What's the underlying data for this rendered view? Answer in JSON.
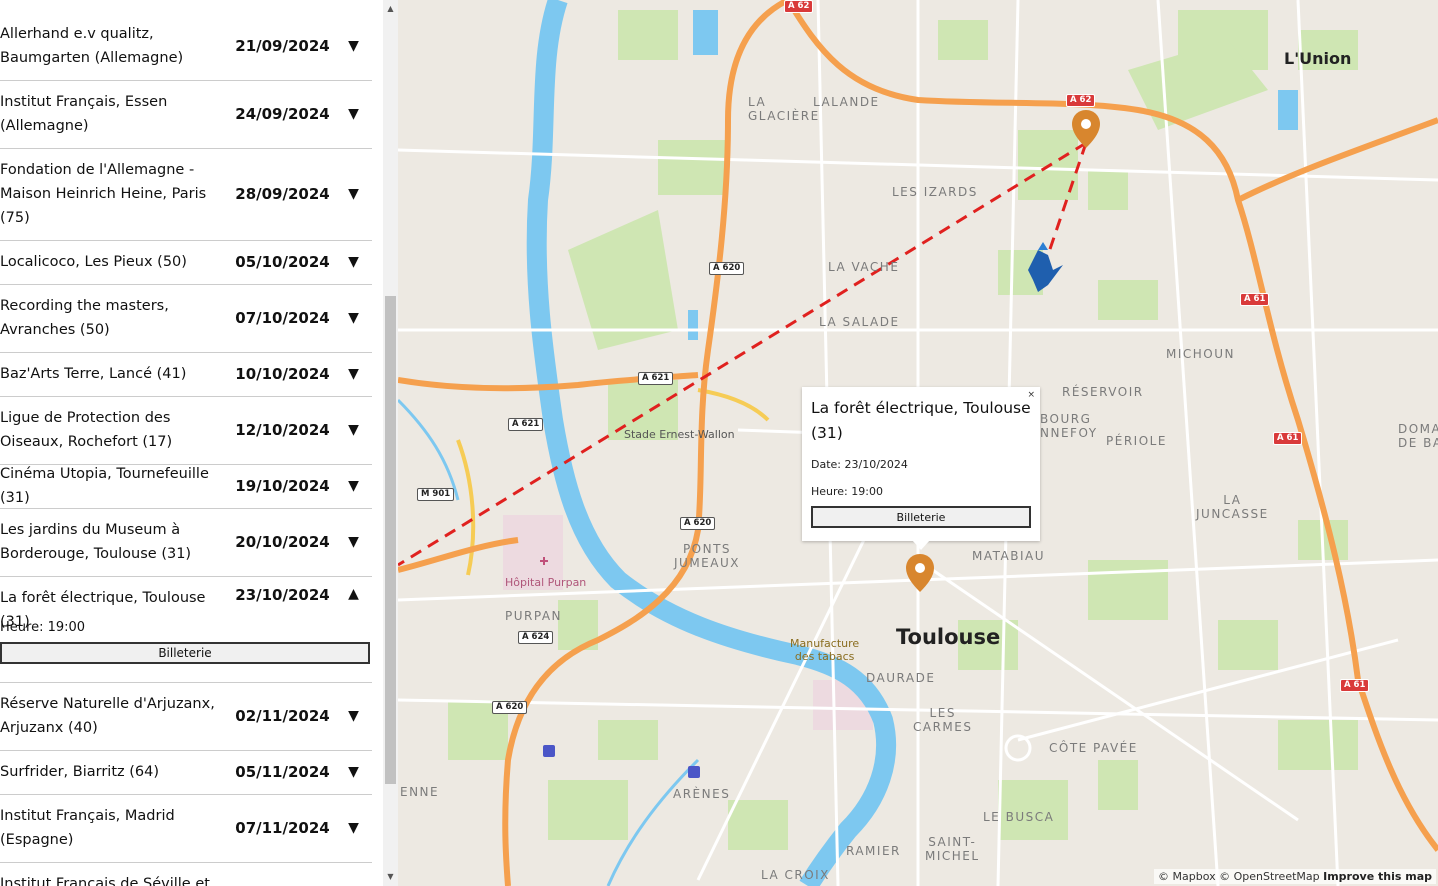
{
  "events": [
    {
      "venue": "Allerhand e.v qualitz, Baumgarten (Allemagne)",
      "date": "21/09/2024",
      "arrow": "▼"
    },
    {
      "venue": "Institut Français, Essen (Allemagne)",
      "date": "24/09/2024",
      "arrow": "▼"
    },
    {
      "venue": "Fondation de l'Allemagne - Maison Heinrich Heine, Paris (75)",
      "date": "28/09/2024",
      "arrow": "▼"
    },
    {
      "venue": "Localicoco, Les Pieux (50)",
      "date": "05/10/2024",
      "arrow": "▼"
    },
    {
      "venue": "Recording the masters, Avranches (50)",
      "date": "07/10/2024",
      "arrow": "▼"
    },
    {
      "venue": "Baz'Arts Terre, Lancé (41)",
      "date": "10/10/2024",
      "arrow": "▼"
    },
    {
      "venue": "Ligue de Protection des Oiseaux, Rochefort (17)",
      "date": "12/10/2024",
      "arrow": "▼"
    },
    {
      "venue": "Cinéma Utopia, Tournefeuille (31)",
      "date": "19/10/2024",
      "arrow": "▼"
    },
    {
      "venue": "Les jardins du Museum à Borderouge, Toulouse (31)",
      "date": "20/10/2024",
      "arrow": "▼"
    },
    {
      "venue": "La forêt électrique, Toulouse (31)",
      "date": "23/10/2024",
      "arrow": "▲",
      "heure": "Heure: 19:00",
      "button": "Billeterie"
    },
    {
      "venue": "Réserve Naturelle d'Arjuzanx, Arjuzanx (40)",
      "date": "02/11/2024",
      "arrow": "▼"
    },
    {
      "venue": "Surfrider, Biarritz (64)",
      "date": "05/11/2024",
      "arrow": "▼"
    },
    {
      "venue": "Institut Français, Madrid (Espagne)",
      "date": "07/11/2024",
      "arrow": "▼"
    },
    {
      "venue": "Institut Français de Séville et",
      "date": "",
      "arrow": ""
    }
  ],
  "popup": {
    "title": "La forêt électrique, Toulouse (31)",
    "date": "Date: 23/10/2024",
    "heure": "Heure: 19:00",
    "button": "Billeterie",
    "close": "×"
  },
  "map": {
    "city": "Toulouse",
    "town": "L'Union",
    "districts": [
      "LA GLACIÈRE",
      "LALANDE",
      "LES IZARDS",
      "LA VACHE",
      "LA SALADE",
      "MICHOUN",
      "RÉSERVOIR",
      "BOURG\nNNEFOY",
      "PÉRIOLE",
      "DOMAI\nDE BAL",
      "LA\nJUNCASSE",
      "MATABIAU",
      "PONTS\nJUMEAUX",
      "PURPAN",
      "DAURADE",
      "LES\nCARMES",
      "CÔTE PAVÉE",
      "ARÈNES",
      "ENNE",
      "LE BUSCA",
      "SAINT-\nMICHEL",
      "RAMIER",
      "LA CROIX"
    ],
    "pois": {
      "stadium": "Stade Ernest-Wallon",
      "hospital": "Hôpital Purpan",
      "manufacture": "Manufacture\ndes tabacs"
    },
    "shields": [
      "A 62",
      "A 62",
      "A 620",
      "A 621",
      "A 621",
      "A 620",
      "A 624",
      "A 620",
      "M 901",
      "A 61",
      "A 61",
      "A 61"
    ],
    "accent_route": "#e0211f",
    "pin_color": "#d8862e"
  },
  "attribution": {
    "mapbox": "© Mapbox",
    "osm": "© OpenStreetMap",
    "improve": "Improve this map"
  }
}
